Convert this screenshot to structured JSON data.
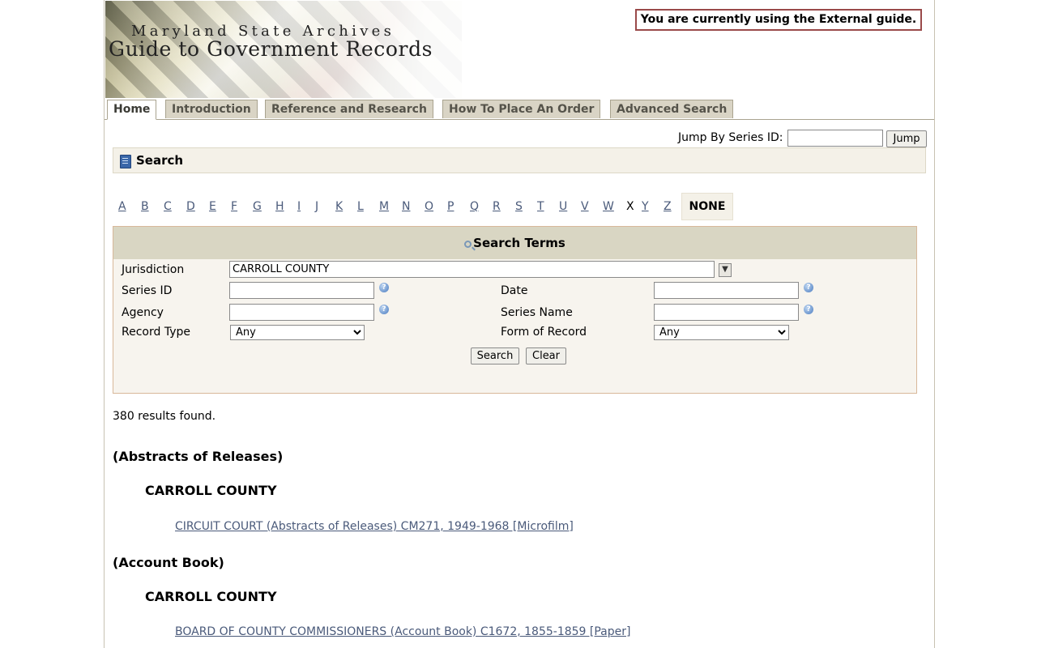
{
  "header": {
    "subtitle": "Maryland State Archives",
    "title": "Guide to Government Records",
    "notice": "You are currently using the External guide."
  },
  "tabs": [
    {
      "label": "Home",
      "active": true
    },
    {
      "label": "Introduction",
      "active": false
    },
    {
      "label": "Reference and Research",
      "active": false
    },
    {
      "label": "How To Place An Order",
      "active": false
    },
    {
      "label": "Advanced Search",
      "active": false
    }
  ],
  "jump": {
    "label": "Jump By Series ID:",
    "value": "",
    "button": "Jump"
  },
  "search": {
    "heading": "Search",
    "book_icon": "book-icon"
  },
  "alphabet": {
    "letters": [
      "A",
      "B",
      "C",
      "D",
      "E",
      "F",
      "G",
      "H",
      "I",
      "J",
      "K",
      "L",
      "M",
      "N",
      "O",
      "P",
      "Q",
      "R",
      "S",
      "T",
      "U",
      "V",
      "W",
      "X",
      "Y",
      "Z"
    ],
    "current_letter": "X",
    "none_label": "NONE"
  },
  "terms": {
    "heading": "Search Terms",
    "jurisdiction_label": "Jurisdiction",
    "jurisdiction_value": "CARROLL COUNTY",
    "series_id_label": "Series ID",
    "series_id_value": "",
    "date_label": "Date",
    "date_value": "",
    "agency_label": "Agency",
    "agency_value": "",
    "series_name_label": "Series Name",
    "series_name_value": "",
    "record_type_label": "Record Type",
    "record_type_value": "Any",
    "form_label": "Form of Record",
    "form_value": "Any",
    "search_button": "Search",
    "clear_button": "Clear"
  },
  "results": {
    "count": "380 results found.",
    "groups": [
      {
        "record_type": "(Abstracts of Releases)",
        "jurisdiction": "CARROLL COUNTY",
        "link": "CIRCUIT COURT (Abstracts of Releases) CM271, 1949-1968 [Microfilm]"
      },
      {
        "record_type": "(Account Book)",
        "jurisdiction": "CARROLL COUNTY",
        "link": "BOARD OF COUNTY COMMISSIONERS (Account Book) C1672, 1855-1859 [Paper]"
      }
    ]
  },
  "colors": {
    "tab_bg": "#d9d4c5",
    "panel_bg": "#f4f1e8",
    "terms_header_bg": "#d9d6c3",
    "link": "#4a5a7a",
    "notice_border": "#9a4a4a"
  }
}
